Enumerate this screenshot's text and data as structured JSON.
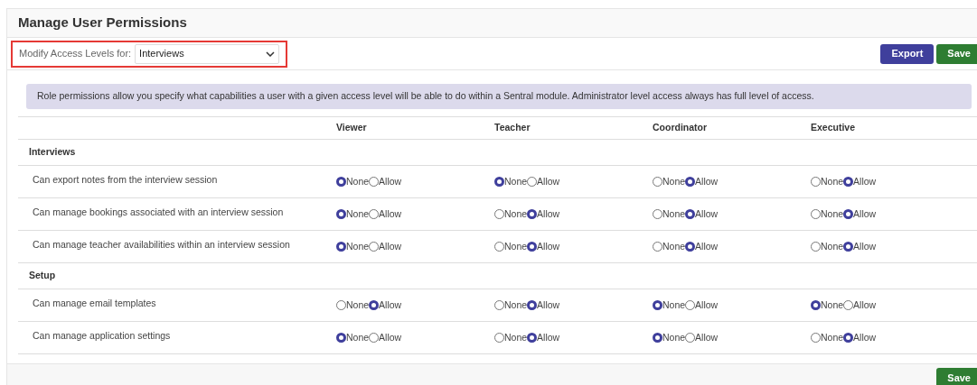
{
  "title": "Manage User Permissions",
  "filter": {
    "label": "Modify Access Levels for:",
    "value": "Interviews",
    "highlighted": true
  },
  "toolbar_buttons": [
    {
      "label": "Export",
      "kind": "primary"
    },
    {
      "label": "Save",
      "kind": "success"
    }
  ],
  "info": "Role permissions allow you specify what capabilities a user with a given access level will be able to do within a Sentral module. Administrator level access always has full level of access.",
  "columns": [
    "Viewer",
    "Teacher",
    "Coordinator",
    "Executive"
  ],
  "sections": [
    {
      "name": "Interviews",
      "rows": [
        {
          "label": "Can export notes from the interview session",
          "cells": [
            [
              {
                "label": "None",
                "selected": true
              },
              {
                "label": "Allow",
                "selected": false
              }
            ],
            [
              {
                "label": "None",
                "selected": true
              },
              {
                "label": "Allow",
                "selected": false
              }
            ],
            [
              {
                "label": "None",
                "selected": false
              },
              {
                "label": "Allow",
                "selected": true
              }
            ],
            [
              {
                "label": "None",
                "selected": false
              },
              {
                "label": "Allow",
                "selected": true
              }
            ]
          ]
        },
        {
          "label": "Can manage bookings associated with an interview session",
          "cells": [
            [
              {
                "label": "None",
                "selected": true
              },
              {
                "label": "Allow",
                "selected": false
              }
            ],
            [
              {
                "label": "None",
                "selected": false
              },
              {
                "label": "Allow",
                "selected": true
              }
            ],
            [
              {
                "label": "None",
                "selected": false
              },
              {
                "label": "Allow",
                "selected": true
              }
            ],
            [
              {
                "label": "None",
                "selected": false
              },
              {
                "label": "Allow",
                "selected": true
              }
            ]
          ]
        },
        {
          "label": "Can manage teacher availabilities within an interview session",
          "cells": [
            [
              {
                "label": "None",
                "selected": true
              },
              {
                "label": "Allow",
                "selected": false
              }
            ],
            [
              {
                "label": "None",
                "selected": false
              },
              {
                "label": "Allow",
                "selected": true
              }
            ],
            [
              {
                "label": "None",
                "selected": false
              },
              {
                "label": "Allow",
                "selected": true
              }
            ],
            [
              {
                "label": "None",
                "selected": false
              },
              {
                "label": "Allow",
                "selected": true
              }
            ]
          ]
        }
      ]
    },
    {
      "name": "Setup",
      "rows": [
        {
          "label": "Can manage email templates",
          "cells": [
            [
              {
                "label": "None",
                "selected": false
              },
              {
                "label": "Allow",
                "selected": true
              }
            ],
            [
              {
                "label": "None",
                "selected": false
              },
              {
                "label": "Allow",
                "selected": true
              }
            ],
            [
              {
                "label": "None",
                "selected": true
              },
              {
                "label": "Allow",
                "selected": false
              }
            ],
            [
              {
                "label": "None",
                "selected": true
              },
              {
                "label": "Allow",
                "selected": false
              }
            ]
          ]
        },
        {
          "label": "Can manage application settings",
          "cells": [
            [
              {
                "label": "None",
                "selected": true
              },
              {
                "label": "Allow",
                "selected": false
              }
            ],
            [
              {
                "label": "None",
                "selected": false
              },
              {
                "label": "Allow",
                "selected": true
              }
            ],
            [
              {
                "label": "None",
                "selected": true
              },
              {
                "label": "Allow",
                "selected": false
              }
            ],
            [
              {
                "label": "None",
                "selected": false
              },
              {
                "label": "Allow",
                "selected": true
              }
            ]
          ]
        }
      ]
    }
  ],
  "footer_buttons": [
    {
      "label": "Save",
      "kind": "success"
    }
  ]
}
